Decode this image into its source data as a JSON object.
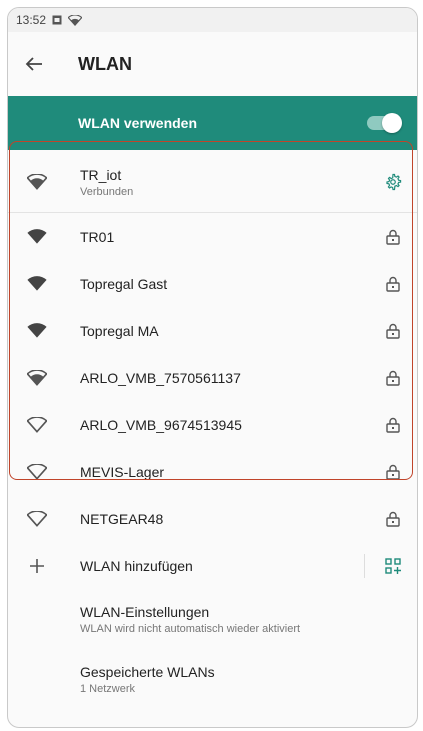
{
  "status": {
    "time": "13:52"
  },
  "appbar": {
    "title": "WLAN"
  },
  "master": {
    "label": "WLAN verwenden"
  },
  "connected": {
    "name": "TR_iot",
    "status": "Verbunden"
  },
  "networks": [
    {
      "name": "TR01",
      "signal": "full"
    },
    {
      "name": "Topregal Gast",
      "signal": "full"
    },
    {
      "name": "Topregal MA",
      "signal": "full"
    },
    {
      "name": "ARLO_VMB_7570561137",
      "signal": "partial"
    },
    {
      "name": "ARLO_VMB_9674513945",
      "signal": "outline"
    },
    {
      "name": "MEVIS-Lager",
      "signal": "outline"
    },
    {
      "name": "NETGEAR48",
      "signal": "outline"
    }
  ],
  "add": {
    "label": "WLAN hinzufügen"
  },
  "settings": [
    {
      "title": "WLAN-Einstellungen",
      "subtitle": "WLAN wird nicht automatisch wieder aktiviert"
    },
    {
      "title": "Gespeicherte WLANs",
      "subtitle": "1 Netzwerk"
    }
  ],
  "colors": {
    "accent": "#1f8b7b",
    "highlight": "#c0442a"
  }
}
